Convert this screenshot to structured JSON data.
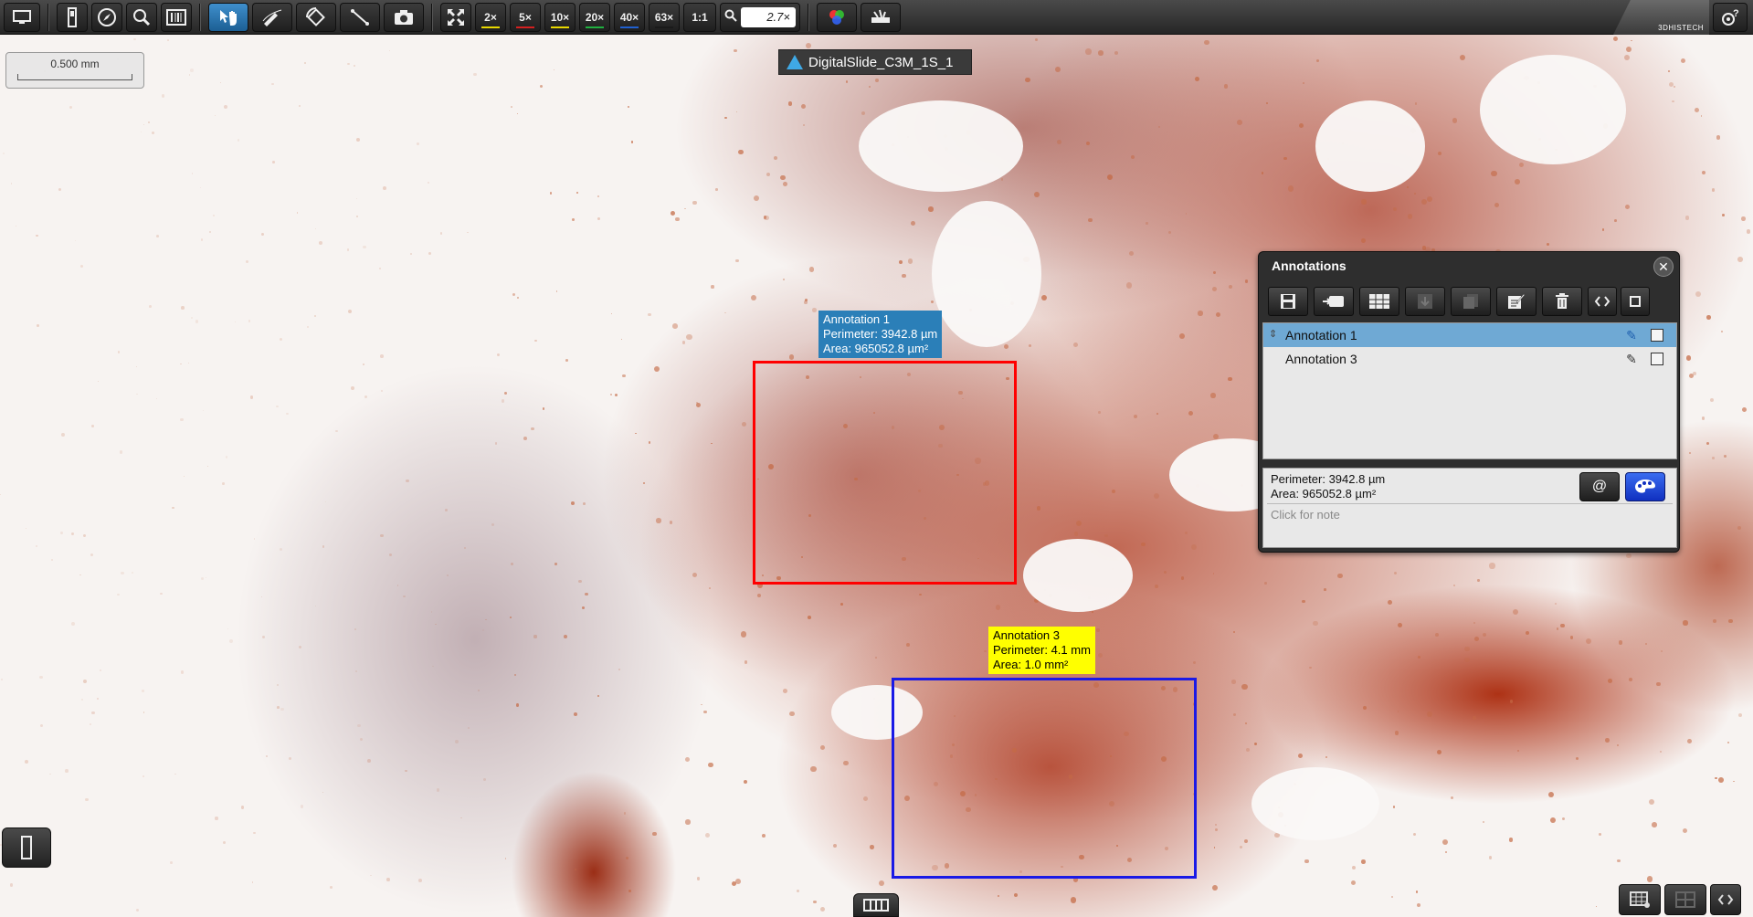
{
  "toolbar": {
    "zoom_levels": [
      {
        "label": "2×",
        "color": "#e8d800"
      },
      {
        "label": "5×",
        "color": "#d42020"
      },
      {
        "label": "10×",
        "color": "#e8d800"
      },
      {
        "label": "20×",
        "color": "#20b040"
      },
      {
        "label": "40×",
        "color": "#2060d0"
      },
      {
        "label": "63×",
        "color": "#1a1a1a"
      }
    ],
    "one_to_one": "1:1",
    "zoom_value": "2.7×",
    "brand": "3DHISTECH"
  },
  "scale_bar": {
    "label": "0.500 mm"
  },
  "slide_tab": {
    "title": "DigitalSlide_C3M_1S_1"
  },
  "annotations_on_slide": [
    {
      "name": "Annotation 1",
      "perimeter": "Perimeter: 3942.8 µm",
      "area": "Area: 965052.8 µm²",
      "border_color": "#ff0000",
      "label_bg": "#2b7fb8",
      "label_fg": "#ffffff"
    },
    {
      "name": "Annotation 3",
      "perimeter": "Perimeter: 4.1 mm",
      "area": "Area: 1.0 mm²",
      "border_color": "#1a1ae6",
      "label_bg": "#ffff00",
      "label_fg": "#000000"
    }
  ],
  "panel": {
    "title": "Annotations",
    "close": "✕",
    "list": [
      {
        "label": "Annotation 1",
        "selected": true
      },
      {
        "label": "Annotation 3",
        "selected": false
      }
    ],
    "details": {
      "perimeter": "Perimeter: 3942.8 µm",
      "area": "Area: 965052.8 µm²",
      "note_placeholder": "Click for note",
      "at_label": "@"
    }
  }
}
